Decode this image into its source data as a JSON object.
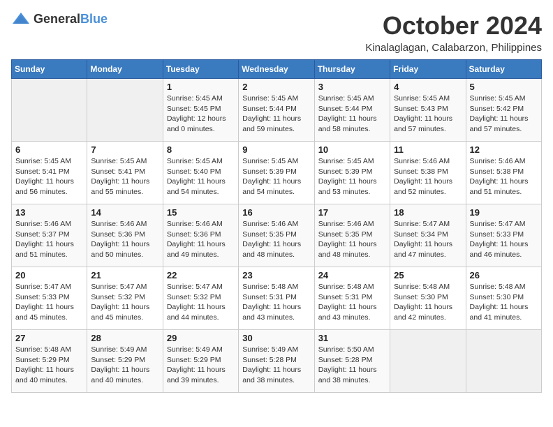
{
  "logo": {
    "general": "General",
    "blue": "Blue"
  },
  "header": {
    "month": "October 2024",
    "location": "Kinalaglagan, Calabarzon, Philippines"
  },
  "weekdays": [
    "Sunday",
    "Monday",
    "Tuesday",
    "Wednesday",
    "Thursday",
    "Friday",
    "Saturday"
  ],
  "weeks": [
    [
      {
        "day": "",
        "detail": ""
      },
      {
        "day": "",
        "detail": ""
      },
      {
        "day": "1",
        "detail": "Sunrise: 5:45 AM\nSunset: 5:45 PM\nDaylight: 12 hours\nand 0 minutes."
      },
      {
        "day": "2",
        "detail": "Sunrise: 5:45 AM\nSunset: 5:44 PM\nDaylight: 11 hours\nand 59 minutes."
      },
      {
        "day": "3",
        "detail": "Sunrise: 5:45 AM\nSunset: 5:44 PM\nDaylight: 11 hours\nand 58 minutes."
      },
      {
        "day": "4",
        "detail": "Sunrise: 5:45 AM\nSunset: 5:43 PM\nDaylight: 11 hours\nand 57 minutes."
      },
      {
        "day": "5",
        "detail": "Sunrise: 5:45 AM\nSunset: 5:42 PM\nDaylight: 11 hours\nand 57 minutes."
      }
    ],
    [
      {
        "day": "6",
        "detail": "Sunrise: 5:45 AM\nSunset: 5:41 PM\nDaylight: 11 hours\nand 56 minutes."
      },
      {
        "day": "7",
        "detail": "Sunrise: 5:45 AM\nSunset: 5:41 PM\nDaylight: 11 hours\nand 55 minutes."
      },
      {
        "day": "8",
        "detail": "Sunrise: 5:45 AM\nSunset: 5:40 PM\nDaylight: 11 hours\nand 54 minutes."
      },
      {
        "day": "9",
        "detail": "Sunrise: 5:45 AM\nSunset: 5:39 PM\nDaylight: 11 hours\nand 54 minutes."
      },
      {
        "day": "10",
        "detail": "Sunrise: 5:45 AM\nSunset: 5:39 PM\nDaylight: 11 hours\nand 53 minutes."
      },
      {
        "day": "11",
        "detail": "Sunrise: 5:46 AM\nSunset: 5:38 PM\nDaylight: 11 hours\nand 52 minutes."
      },
      {
        "day": "12",
        "detail": "Sunrise: 5:46 AM\nSunset: 5:38 PM\nDaylight: 11 hours\nand 51 minutes."
      }
    ],
    [
      {
        "day": "13",
        "detail": "Sunrise: 5:46 AM\nSunset: 5:37 PM\nDaylight: 11 hours\nand 51 minutes."
      },
      {
        "day": "14",
        "detail": "Sunrise: 5:46 AM\nSunset: 5:36 PM\nDaylight: 11 hours\nand 50 minutes."
      },
      {
        "day": "15",
        "detail": "Sunrise: 5:46 AM\nSunset: 5:36 PM\nDaylight: 11 hours\nand 49 minutes."
      },
      {
        "day": "16",
        "detail": "Sunrise: 5:46 AM\nSunset: 5:35 PM\nDaylight: 11 hours\nand 48 minutes."
      },
      {
        "day": "17",
        "detail": "Sunrise: 5:46 AM\nSunset: 5:35 PM\nDaylight: 11 hours\nand 48 minutes."
      },
      {
        "day": "18",
        "detail": "Sunrise: 5:47 AM\nSunset: 5:34 PM\nDaylight: 11 hours\nand 47 minutes."
      },
      {
        "day": "19",
        "detail": "Sunrise: 5:47 AM\nSunset: 5:33 PM\nDaylight: 11 hours\nand 46 minutes."
      }
    ],
    [
      {
        "day": "20",
        "detail": "Sunrise: 5:47 AM\nSunset: 5:33 PM\nDaylight: 11 hours\nand 45 minutes."
      },
      {
        "day": "21",
        "detail": "Sunrise: 5:47 AM\nSunset: 5:32 PM\nDaylight: 11 hours\nand 45 minutes."
      },
      {
        "day": "22",
        "detail": "Sunrise: 5:47 AM\nSunset: 5:32 PM\nDaylight: 11 hours\nand 44 minutes."
      },
      {
        "day": "23",
        "detail": "Sunrise: 5:48 AM\nSunset: 5:31 PM\nDaylight: 11 hours\nand 43 minutes."
      },
      {
        "day": "24",
        "detail": "Sunrise: 5:48 AM\nSunset: 5:31 PM\nDaylight: 11 hours\nand 43 minutes."
      },
      {
        "day": "25",
        "detail": "Sunrise: 5:48 AM\nSunset: 5:30 PM\nDaylight: 11 hours\nand 42 minutes."
      },
      {
        "day": "26",
        "detail": "Sunrise: 5:48 AM\nSunset: 5:30 PM\nDaylight: 11 hours\nand 41 minutes."
      }
    ],
    [
      {
        "day": "27",
        "detail": "Sunrise: 5:48 AM\nSunset: 5:29 PM\nDaylight: 11 hours\nand 40 minutes."
      },
      {
        "day": "28",
        "detail": "Sunrise: 5:49 AM\nSunset: 5:29 PM\nDaylight: 11 hours\nand 40 minutes."
      },
      {
        "day": "29",
        "detail": "Sunrise: 5:49 AM\nSunset: 5:29 PM\nDaylight: 11 hours\nand 39 minutes."
      },
      {
        "day": "30",
        "detail": "Sunrise: 5:49 AM\nSunset: 5:28 PM\nDaylight: 11 hours\nand 38 minutes."
      },
      {
        "day": "31",
        "detail": "Sunrise: 5:50 AM\nSunset: 5:28 PM\nDaylight: 11 hours\nand 38 minutes."
      },
      {
        "day": "",
        "detail": ""
      },
      {
        "day": "",
        "detail": ""
      }
    ]
  ]
}
